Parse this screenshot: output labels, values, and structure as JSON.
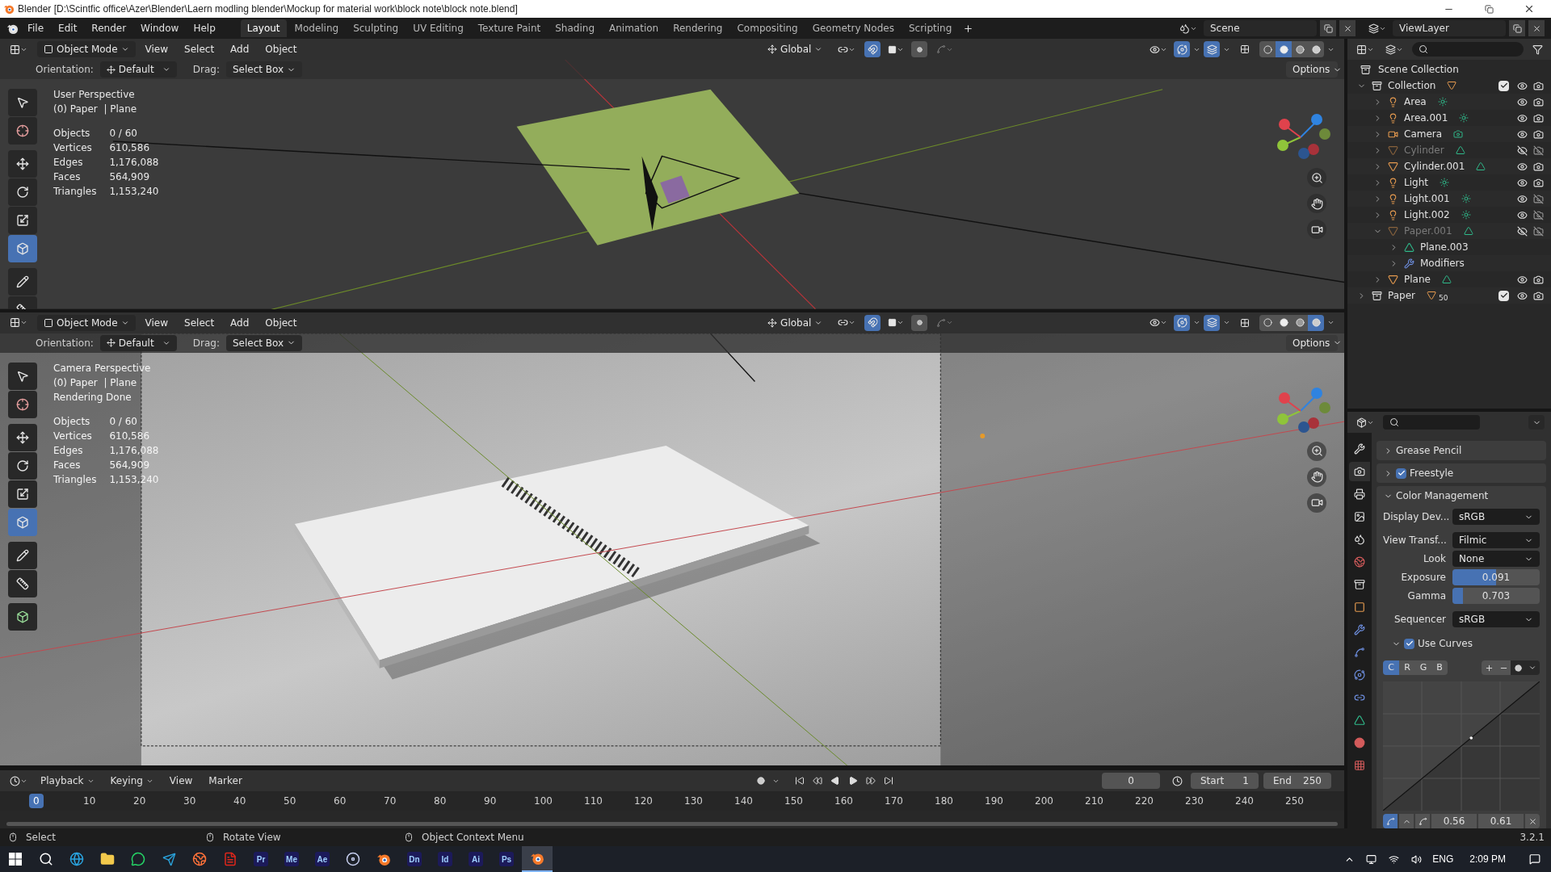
{
  "title_bar": {
    "title": "Blender [D:\\Scintfic office\\Azer\\Blender\\Laern modling blender\\Mockup for material work\\block note\\block note.blend]"
  },
  "menu": [
    "File",
    "Edit",
    "Render",
    "Window",
    "Help"
  ],
  "workspaces": [
    {
      "label": "Layout",
      "selected": true
    },
    {
      "label": "Modeling",
      "selected": false
    },
    {
      "label": "Sculpting",
      "selected": false
    },
    {
      "label": "UV Editing",
      "selected": false
    },
    {
      "label": "Texture Paint",
      "selected": false
    },
    {
      "label": "Shading",
      "selected": false
    },
    {
      "label": "Animation",
      "selected": false
    },
    {
      "label": "Rendering",
      "selected": false
    },
    {
      "label": "Compositing",
      "selected": false
    },
    {
      "label": "Geometry Nodes",
      "selected": false
    },
    {
      "label": "Scripting",
      "selected": false
    }
  ],
  "scene": "Scene",
  "view_layer": "ViewLayer",
  "viewports": [
    {
      "kind": "solid",
      "mode": "Object Mode",
      "menus": [
        "View",
        "Select",
        "Add",
        "Object"
      ],
      "transform": "Global",
      "options": "Options",
      "orientation_label": "Orientation:",
      "orientation": "Default",
      "drag_label": "Drag:",
      "drag": "Select Box",
      "shading": [
        {
          "selected": false
        },
        {
          "selected": true
        },
        {
          "selected": false
        },
        {
          "selected": false
        }
      ],
      "info": [
        "User Perspective",
        "(0) Paper  | Plane"
      ],
      "stats": [
        {
          "label": "Objects",
          "value": "0 / 60"
        },
        {
          "label": "Vertices",
          "value": "610,586"
        },
        {
          "label": "Edges",
          "value": "1,176,088"
        },
        {
          "label": "Faces",
          "value": "564,909"
        },
        {
          "label": "Triangles",
          "value": "1,153,240"
        }
      ]
    },
    {
      "kind": "rendered",
      "mode": "Object Mode",
      "menus": [
        "View",
        "Select",
        "Add",
        "Object"
      ],
      "transform": "Global",
      "options": "Options",
      "orientation_label": "Orientation:",
      "orientation": "Default",
      "drag_label": "Drag:",
      "drag": "Select Box",
      "shading": [
        {
          "selected": false
        },
        {
          "selected": false
        },
        {
          "selected": false
        },
        {
          "selected": true
        }
      ],
      "info": [
        "Camera Perspective",
        "(0) Paper  | Plane",
        "Rendering Done"
      ],
      "stats": [
        {
          "label": "Objects",
          "value": "0 / 60"
        },
        {
          "label": "Vertices",
          "value": "610,586"
        },
        {
          "label": "Edges",
          "value": "1,176,088"
        },
        {
          "label": "Faces",
          "value": "564,909"
        },
        {
          "label": "Triangles",
          "value": "1,153,240"
        }
      ]
    }
  ],
  "outliner": {
    "root": "Scene Collection",
    "items": [
      {
        "name": "Collection",
        "kind": "collection",
        "expanded": true,
        "checked": true,
        "hidden": false,
        "render": true,
        "children": [
          {
            "name": "Area",
            "kind": "light",
            "expanded": false,
            "hidden": false,
            "render": true
          },
          {
            "name": "Area.001",
            "kind": "light",
            "expanded": false,
            "hidden": false,
            "render": true
          },
          {
            "name": "Camera",
            "kind": "camera",
            "expanded": false,
            "hidden": false,
            "render": true
          },
          {
            "name": "Cylinder",
            "kind": "mesh",
            "expanded": false,
            "hidden": true,
            "render": false
          },
          {
            "name": "Cylinder.001",
            "kind": "mesh",
            "expanded": false,
            "hidden": false,
            "render": true
          },
          {
            "name": "Light",
            "kind": "light",
            "expanded": false,
            "hidden": false,
            "render": true
          },
          {
            "name": "Light.001",
            "kind": "light",
            "expanded": false,
            "hidden": false,
            "render": false
          },
          {
            "name": "Light.002",
            "kind": "light",
            "expanded": false,
            "hidden": false,
            "render": false
          },
          {
            "name": "Paper.001",
            "kind": "mesh",
            "expanded": true,
            "hidden": true,
            "render": false,
            "children": [
              {
                "name": "Plane.003",
                "kind": "data",
                "expanded": false
              },
              {
                "name": "Modifiers",
                "kind": "modifiers",
                "expanded": false
              }
            ]
          },
          {
            "name": "Plane",
            "kind": "mesh",
            "expanded": false,
            "hidden": false,
            "render": true
          }
        ]
      },
      {
        "name": "Paper",
        "kind": "collection",
        "expanded": false,
        "checked": true,
        "hidden": false,
        "render": true,
        "badge": "50"
      }
    ]
  },
  "properties": {
    "tabs": [
      {
        "kind": "tool",
        "selected": false
      },
      {
        "kind": "render",
        "selected": true
      },
      {
        "kind": "output",
        "selected": false
      },
      {
        "kind": "view-layer",
        "selected": false
      },
      {
        "kind": "scene",
        "selected": false
      },
      {
        "kind": "world",
        "selected": false
      },
      {
        "kind": "collection",
        "selected": false
      },
      {
        "kind": "object",
        "selected": false
      },
      {
        "kind": "modifier",
        "selected": false
      },
      {
        "kind": "particles",
        "selected": false
      },
      {
        "kind": "physics",
        "selected": false
      },
      {
        "kind": "constraint",
        "selected": false
      },
      {
        "kind": "data",
        "selected": false
      },
      {
        "kind": "material",
        "selected": false
      },
      {
        "kind": "texture",
        "selected": false
      }
    ],
    "panels": [
      {
        "title": "Grease Pencil",
        "expanded": false
      },
      {
        "title": "Freestyle",
        "expanded": false,
        "checked": true
      },
      {
        "title": "Color Management",
        "expanded": true,
        "fields": [
          {
            "kind": "dropdown",
            "label": "Display Dev...",
            "value": "sRGB"
          },
          {
            "kind": "dropdown",
            "label": "View Transf...",
            "value": "Filmic"
          },
          {
            "kind": "dropdown",
            "label": "Look",
            "value": "None"
          },
          {
            "kind": "slider",
            "label": "Exposure",
            "value": "0.091",
            "level": 0.5
          },
          {
            "kind": "slider",
            "label": "Gamma",
            "value": "0.703",
            "level": 0.12
          },
          {
            "kind": "dropdown",
            "label": "Sequencer",
            "value": "sRGB"
          }
        ],
        "curves": {
          "label": "Use Curves",
          "checked": true,
          "expanded": true,
          "channels": [
            {
              "label": "C",
              "selected": true
            },
            {
              "label": "R",
              "selected": false
            },
            {
              "label": "G",
              "selected": false
            },
            {
              "label": "B",
              "selected": false
            }
          ],
          "point": [
            "0.56",
            "0.61"
          ]
        }
      }
    ]
  },
  "timeline": {
    "menus": [
      "Playback",
      "Keying",
      "View",
      "Marker"
    ],
    "current": "0",
    "start_label": "Start",
    "start": "1",
    "end_label": "End",
    "end": "250",
    "frames": [
      {
        "label": "0",
        "selected": true
      },
      {
        "label": "10",
        "selected": false
      },
      {
        "label": "20",
        "selected": false
      },
      {
        "label": "30",
        "selected": false
      },
      {
        "label": "40",
        "selected": false
      },
      {
        "label": "50",
        "selected": false
      },
      {
        "label": "60",
        "selected": false
      },
      {
        "label": "70",
        "selected": false
      },
      {
        "label": "80",
        "selected": false
      },
      {
        "label": "90",
        "selected": false
      },
      {
        "label": "100",
        "selected": false
      },
      {
        "label": "110",
        "selected": false
      },
      {
        "label": "120",
        "selected": false
      },
      {
        "label": "130",
        "selected": false
      },
      {
        "label": "140",
        "selected": false
      },
      {
        "label": "150",
        "selected": false
      },
      {
        "label": "160",
        "selected": false
      },
      {
        "label": "170",
        "selected": false
      },
      {
        "label": "180",
        "selected": false
      },
      {
        "label": "190",
        "selected": false
      },
      {
        "label": "200",
        "selected": false
      },
      {
        "label": "210",
        "selected": false
      },
      {
        "label": "220",
        "selected": false
      },
      {
        "label": "230",
        "selected": false
      },
      {
        "label": "240",
        "selected": false
      },
      {
        "label": "250",
        "selected": false
      }
    ]
  },
  "status_bar": {
    "hints": [
      "Select",
      "Rotate View",
      "Object Context Menu"
    ],
    "version": "3.2.1"
  },
  "taskbar": {
    "apps": [
      {
        "kind": "search",
        "selected": false
      },
      {
        "kind": "browser",
        "selected": false
      },
      {
        "kind": "folder",
        "selected": false
      },
      {
        "kind": "chat",
        "selected": false
      },
      {
        "kind": "send",
        "selected": false
      },
      {
        "kind": "globe",
        "selected": false
      },
      {
        "kind": "document",
        "selected": false
      },
      {
        "kind": "letters",
        "label": "Pr",
        "selected": false
      },
      {
        "kind": "letters",
        "label": "Me",
        "selected": false
      },
      {
        "kind": "letters",
        "label": "Ae",
        "selected": false
      },
      {
        "kind": "record",
        "selected": false
      },
      {
        "kind": "blender",
        "selected": false
      },
      {
        "kind": "letters",
        "label": "Dn",
        "selected": false
      },
      {
        "kind": "letters",
        "label": "Id",
        "selected": false
      },
      {
        "kind": "letters",
        "label": "Ai",
        "selected": false
      },
      {
        "kind": "letters",
        "label": "Ps",
        "selected": false
      },
      {
        "kind": "blender",
        "selected": true
      }
    ],
    "language": "ENG",
    "time": "2:09 PM"
  }
}
